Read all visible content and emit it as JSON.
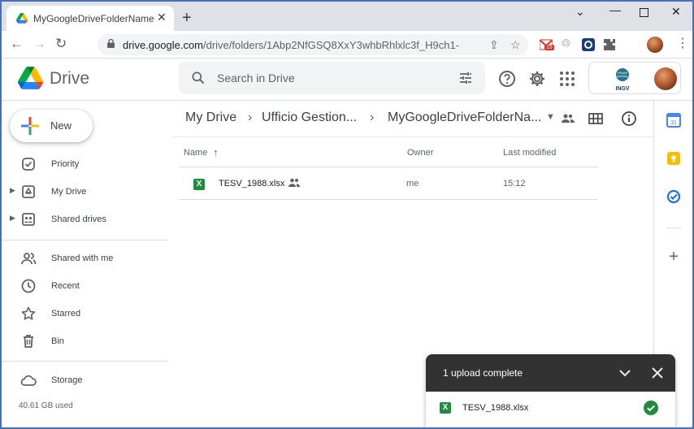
{
  "browser": {
    "tab_title": "MyGoogleDriveFolderName - Google Drive",
    "url_host": "drive.google.com",
    "url_path": "/drive/folders/1Abp2NfGSQ8XxY3whbRhlxlc3f_H9ch1-",
    "extension_badge": "15"
  },
  "app": {
    "logo_text": "Drive",
    "search_placeholder": "Search in Drive",
    "org_logo_text": "INGV"
  },
  "sidebar": {
    "new_label": "New",
    "items": [
      {
        "label": "Priority",
        "icon": "priority-icon",
        "expandable": false
      },
      {
        "label": "My Drive",
        "icon": "my-drive-icon",
        "expandable": true
      },
      {
        "label": "Shared drives",
        "icon": "shared-drives-icon",
        "expandable": true
      },
      {
        "label": "Shared with me",
        "icon": "shared-with-me-icon",
        "expandable": false
      },
      {
        "label": "Recent",
        "icon": "clock-icon",
        "expandable": false
      },
      {
        "label": "Starred",
        "icon": "star-icon",
        "expandable": false
      },
      {
        "label": "Bin",
        "icon": "bin-icon",
        "expandable": false
      },
      {
        "label": "Storage",
        "icon": "cloud-icon",
        "expandable": false
      }
    ],
    "storage_used": "40.61 GB used"
  },
  "breadcrumb": [
    "My Drive",
    "Ufficio Gestion...",
    "MyGoogleDriveFolderNa..."
  ],
  "table": {
    "columns": {
      "name": "Name",
      "owner": "Owner",
      "modified": "Last modified"
    },
    "rows": [
      {
        "name": "TESV_1988.xlsx",
        "owner": "me",
        "modified": "15:12",
        "shared": true
      }
    ]
  },
  "upload": {
    "title": "1 upload complete",
    "file": "TESV_1988.xlsx"
  },
  "colors": {
    "accent": "#1a73e8",
    "excel_green": "#1e8e3e",
    "toast_bg": "#323232",
    "frame_border": "#4a6fb5"
  }
}
